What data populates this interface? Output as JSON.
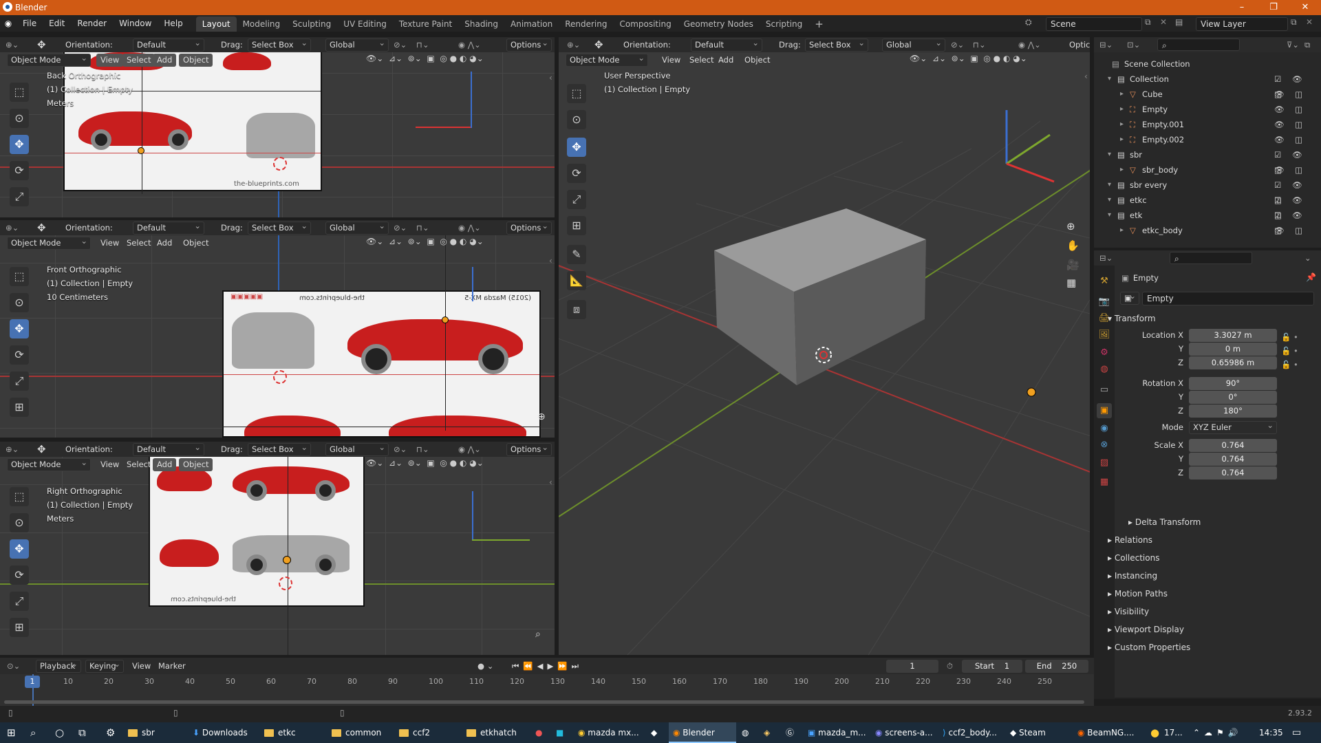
{
  "window": {
    "title": "Blender",
    "version": "2.93.2"
  },
  "menu": [
    "File",
    "Edit",
    "Render",
    "Window",
    "Help"
  ],
  "workspaces": [
    "Layout",
    "Modeling",
    "Sculpting",
    "UV Editing",
    "Texture Paint",
    "Shading",
    "Animation",
    "Rendering",
    "Compositing",
    "Geometry Nodes",
    "Scripting"
  ],
  "scene": {
    "scene_name": "Scene",
    "view_layer": "View Layer"
  },
  "header": {
    "orientation_label": "Orientation:",
    "orientation_value": "Default",
    "drag_label": "Drag:",
    "drag_value": "Select Box",
    "transform_value": "Global",
    "options_label": "Options",
    "options_short": "Optic"
  },
  "viewport_menu": {
    "mode": "Object Mode",
    "view": "View",
    "select": "Select",
    "add": "Add",
    "object": "Object"
  },
  "viewports": [
    {
      "view": "Back Orthographic",
      "collection": "(1) Collection | Empty",
      "unit": "Meters"
    },
    {
      "view": "Front Orthographic",
      "collection": "(1) Collection | Empty",
      "unit": "10 Centimeters"
    },
    {
      "view": "Right Orthographic",
      "collection": "(1) Collection | Empty",
      "unit": "Meters"
    },
    {
      "view": "User Perspective",
      "collection": "(1) Collection | Empty",
      "unit": ""
    }
  ],
  "reference_text": {
    "watermark": "the-blueprints.com",
    "mirrored_model": "(2015) Mazda MX-5",
    "mirrored_watermark": "the-blueprints.com"
  },
  "outliner": {
    "root": "Scene Collection",
    "rows": [
      {
        "label": "Collection",
        "indent": 1
      },
      {
        "label": "Cube",
        "indent": 2
      },
      {
        "label": "Empty",
        "indent": 2
      },
      {
        "label": "Empty.001",
        "indent": 2
      },
      {
        "label": "Empty.002",
        "indent": 2
      },
      {
        "label": "sbr",
        "indent": 1
      },
      {
        "label": "sbr_body",
        "indent": 2
      },
      {
        "label": "sbr every",
        "indent": 1
      },
      {
        "label": "etkc",
        "indent": 1
      },
      {
        "label": "etk",
        "indent": 1
      },
      {
        "label": "etkc_body",
        "indent": 2
      }
    ]
  },
  "properties": {
    "object_name": "Empty",
    "data_name": "Empty",
    "transform_label": "Transform",
    "location_label": "Location X",
    "location": [
      "3.3027 m",
      "0 m",
      "0.65986 m"
    ],
    "rotation_label": "Rotation X",
    "rotation": [
      "90°",
      "0°",
      "180°"
    ],
    "mode_label": "Mode",
    "mode_value": "XYZ Euler",
    "scale_label": "Scale X",
    "scale": [
      "0.764",
      "0.764",
      "0.764"
    ],
    "axis_y": "Y",
    "axis_z": "Z",
    "delta": "Delta Transform",
    "sections": [
      "Relations",
      "Collections",
      "Instancing",
      "Motion Paths",
      "Visibility",
      "Viewport Display",
      "Custom Properties"
    ]
  },
  "timeline": {
    "menus": [
      "Playback",
      "Keying",
      "View",
      "Marker"
    ],
    "current_frame": "1",
    "start_label": "Start",
    "start": "1",
    "end_label": "End",
    "end": "250",
    "ticks": [
      "10",
      "20",
      "30",
      "40",
      "50",
      "60",
      "70",
      "80",
      "90",
      "100",
      "110",
      "120",
      "130",
      "140",
      "150",
      "160",
      "170",
      "180",
      "190",
      "200",
      "210",
      "220",
      "230",
      "240",
      "250"
    ]
  },
  "taskbar": {
    "items": [
      "sbr",
      "Downloads",
      "etkc",
      "common",
      "ccf2",
      "etkhatch",
      "mazda mx...",
      "Blender",
      "mazda_m...",
      "screens-a...",
      "ccf2_body...",
      "Steam",
      "BeamNG...."
    ],
    "weather": "17...",
    "time": "14:35"
  },
  "colors": {
    "accent": "#4772b3",
    "titlebar": "#d05a14",
    "axis_x": "#c23a3a",
    "axis_y": "#7ea82e",
    "axis_z": "#3b6fd1",
    "origin": "#f0a020"
  }
}
